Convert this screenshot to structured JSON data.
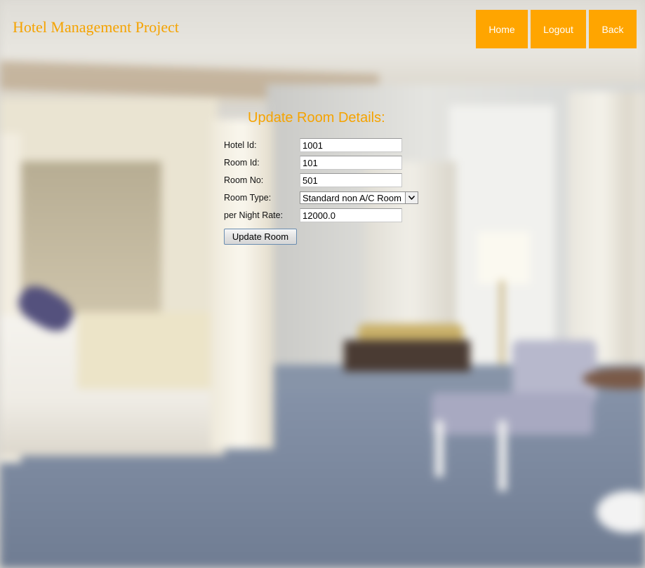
{
  "header": {
    "brand": "Hotel Management Project",
    "nav": {
      "home_label": "Home",
      "logout_label": "Logout",
      "back_label": "Back"
    }
  },
  "form": {
    "title": "Update Room Details:",
    "fields": {
      "hotel_id": {
        "label": "Hotel Id:",
        "value": "1001"
      },
      "room_id": {
        "label": "Room Id:",
        "value": "101"
      },
      "room_no": {
        "label": "Room No:",
        "value": "501"
      },
      "room_type": {
        "label": "Room Type:",
        "selected": "Standard non A/C Room"
      },
      "rate": {
        "label": "per Night Rate:",
        "value": "12000.0"
      }
    },
    "submit_label": "Update Room"
  },
  "colors": {
    "accent": "#ffa500",
    "brand_text": "#f5a300"
  }
}
